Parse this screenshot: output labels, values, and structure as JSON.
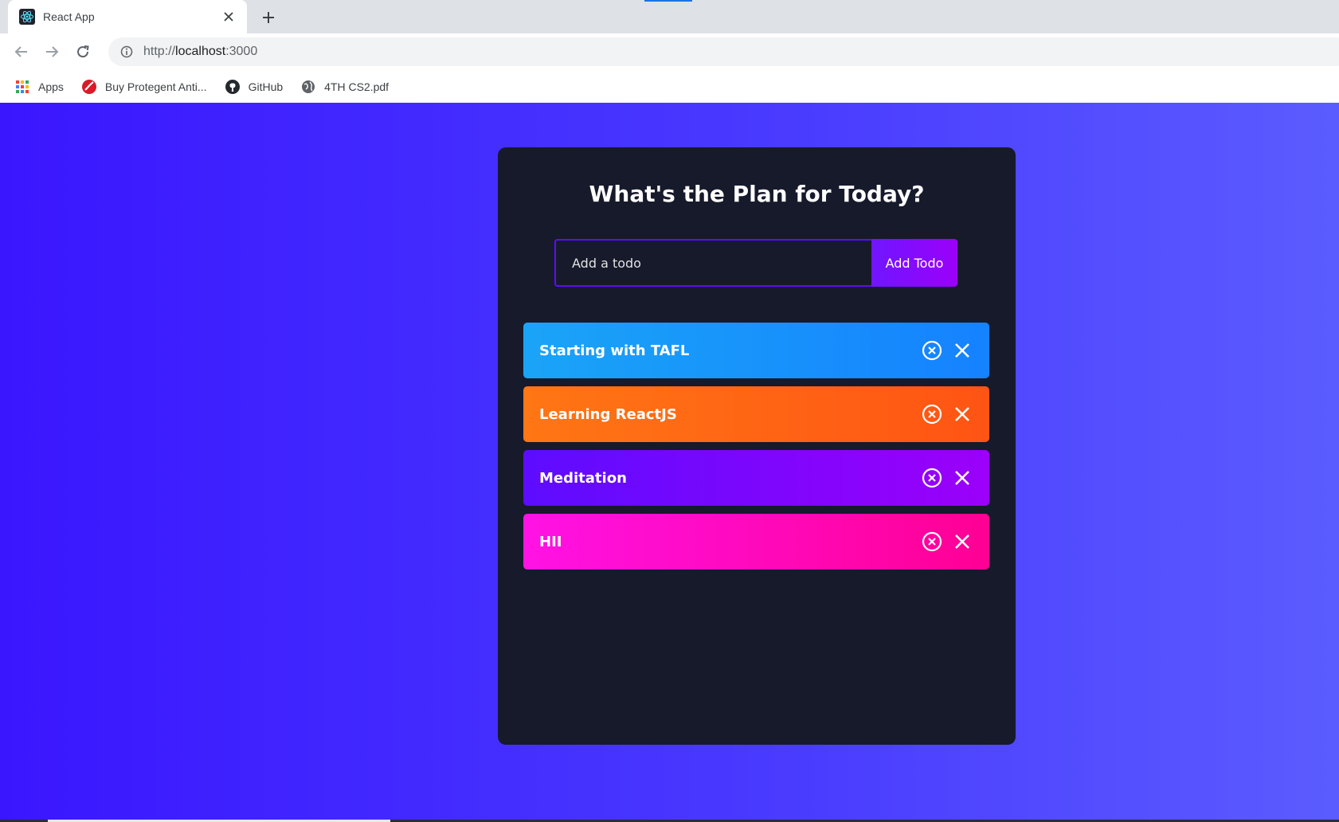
{
  "browser": {
    "tab_title": "React App",
    "url_scheme": "http://",
    "url_host": "localhost",
    "url_port": ":3000",
    "bookmarks": [
      {
        "label": "Apps",
        "icon": "apps-grid-icon"
      },
      {
        "label": "Buy Protegent Anti...",
        "icon": "protegent-icon"
      },
      {
        "label": "GitHub",
        "icon": "github-icon"
      },
      {
        "label": "4TH CS2.pdf",
        "icon": "globe-icon"
      }
    ]
  },
  "app": {
    "title": "What's the Plan for Today?",
    "input_placeholder": "Add a todo",
    "input_value": "",
    "add_button_label": "Add Todo",
    "todos": [
      {
        "text": "Starting with TAFL"
      },
      {
        "text": "Learning ReactJS"
      },
      {
        "text": "Meditation"
      },
      {
        "text": "HII"
      }
    ],
    "row_icons": [
      "close-circle-icon",
      "close-icon"
    ]
  },
  "colors": {
    "background_start": "#3a16ff",
    "background_end": "#5b5cff",
    "card": "#161a2b",
    "accent": "#5d0cff",
    "row_colors": [
      "#1582ff",
      "#ff5414",
      "#9b00fa",
      "#ff0094"
    ]
  }
}
